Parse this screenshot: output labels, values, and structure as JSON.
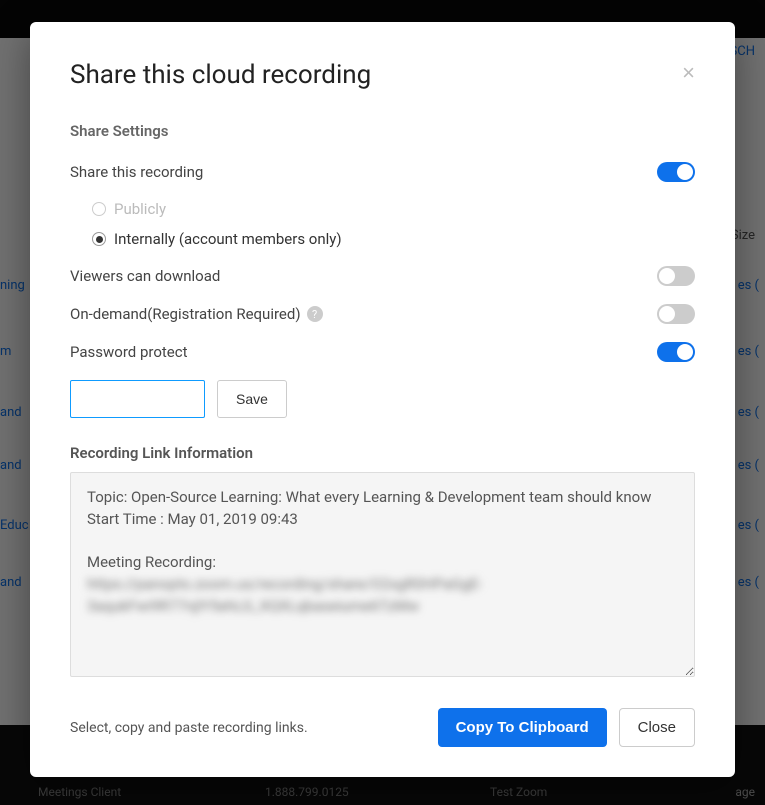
{
  "modal": {
    "title": "Share this cloud recording",
    "close": "×"
  },
  "settings": {
    "heading": "Share Settings",
    "share_label": "Share this recording",
    "share_on": true,
    "radio_public": "Publicly",
    "radio_internal": "Internally (account members only)",
    "radio_selected": "internal",
    "download_label": "Viewers can download",
    "download_on": false,
    "ondemand_label": "On-demand(Registration Required)",
    "ondemand_on": false,
    "password_label": "Password protect",
    "password_on": true,
    "password_value": "",
    "save_label": "Save"
  },
  "linkinfo": {
    "heading": "Recording Link Information",
    "topic_line": "Topic: Open-Source Learning: What every Learning & Development team should know",
    "start_line": "Start Time : May 01, 2019 09:43",
    "mr_label": "Meeting Recording:",
    "blurred1": "https://panopto.zoom.us/recording/share/O2xgR0HPaGgE-",
    "blurred2": "3aqukFwi9R77njlY5ehLG_XQXLqbaseiume6TzMw"
  },
  "footer": {
    "hint": "Select, copy and paste recording links.",
    "copy": "Copy To Clipboard",
    "close": "Close"
  },
  "bg": {
    "sch": "SCH",
    "size": "Size",
    "ning": "ning",
    "m": "m",
    "and": "and",
    "educ": "Educ",
    "es": "es (",
    "age": "age",
    "mc": "Meetings Client",
    "phone": "1.888.799.0125",
    "tz": "Test Zoom"
  }
}
